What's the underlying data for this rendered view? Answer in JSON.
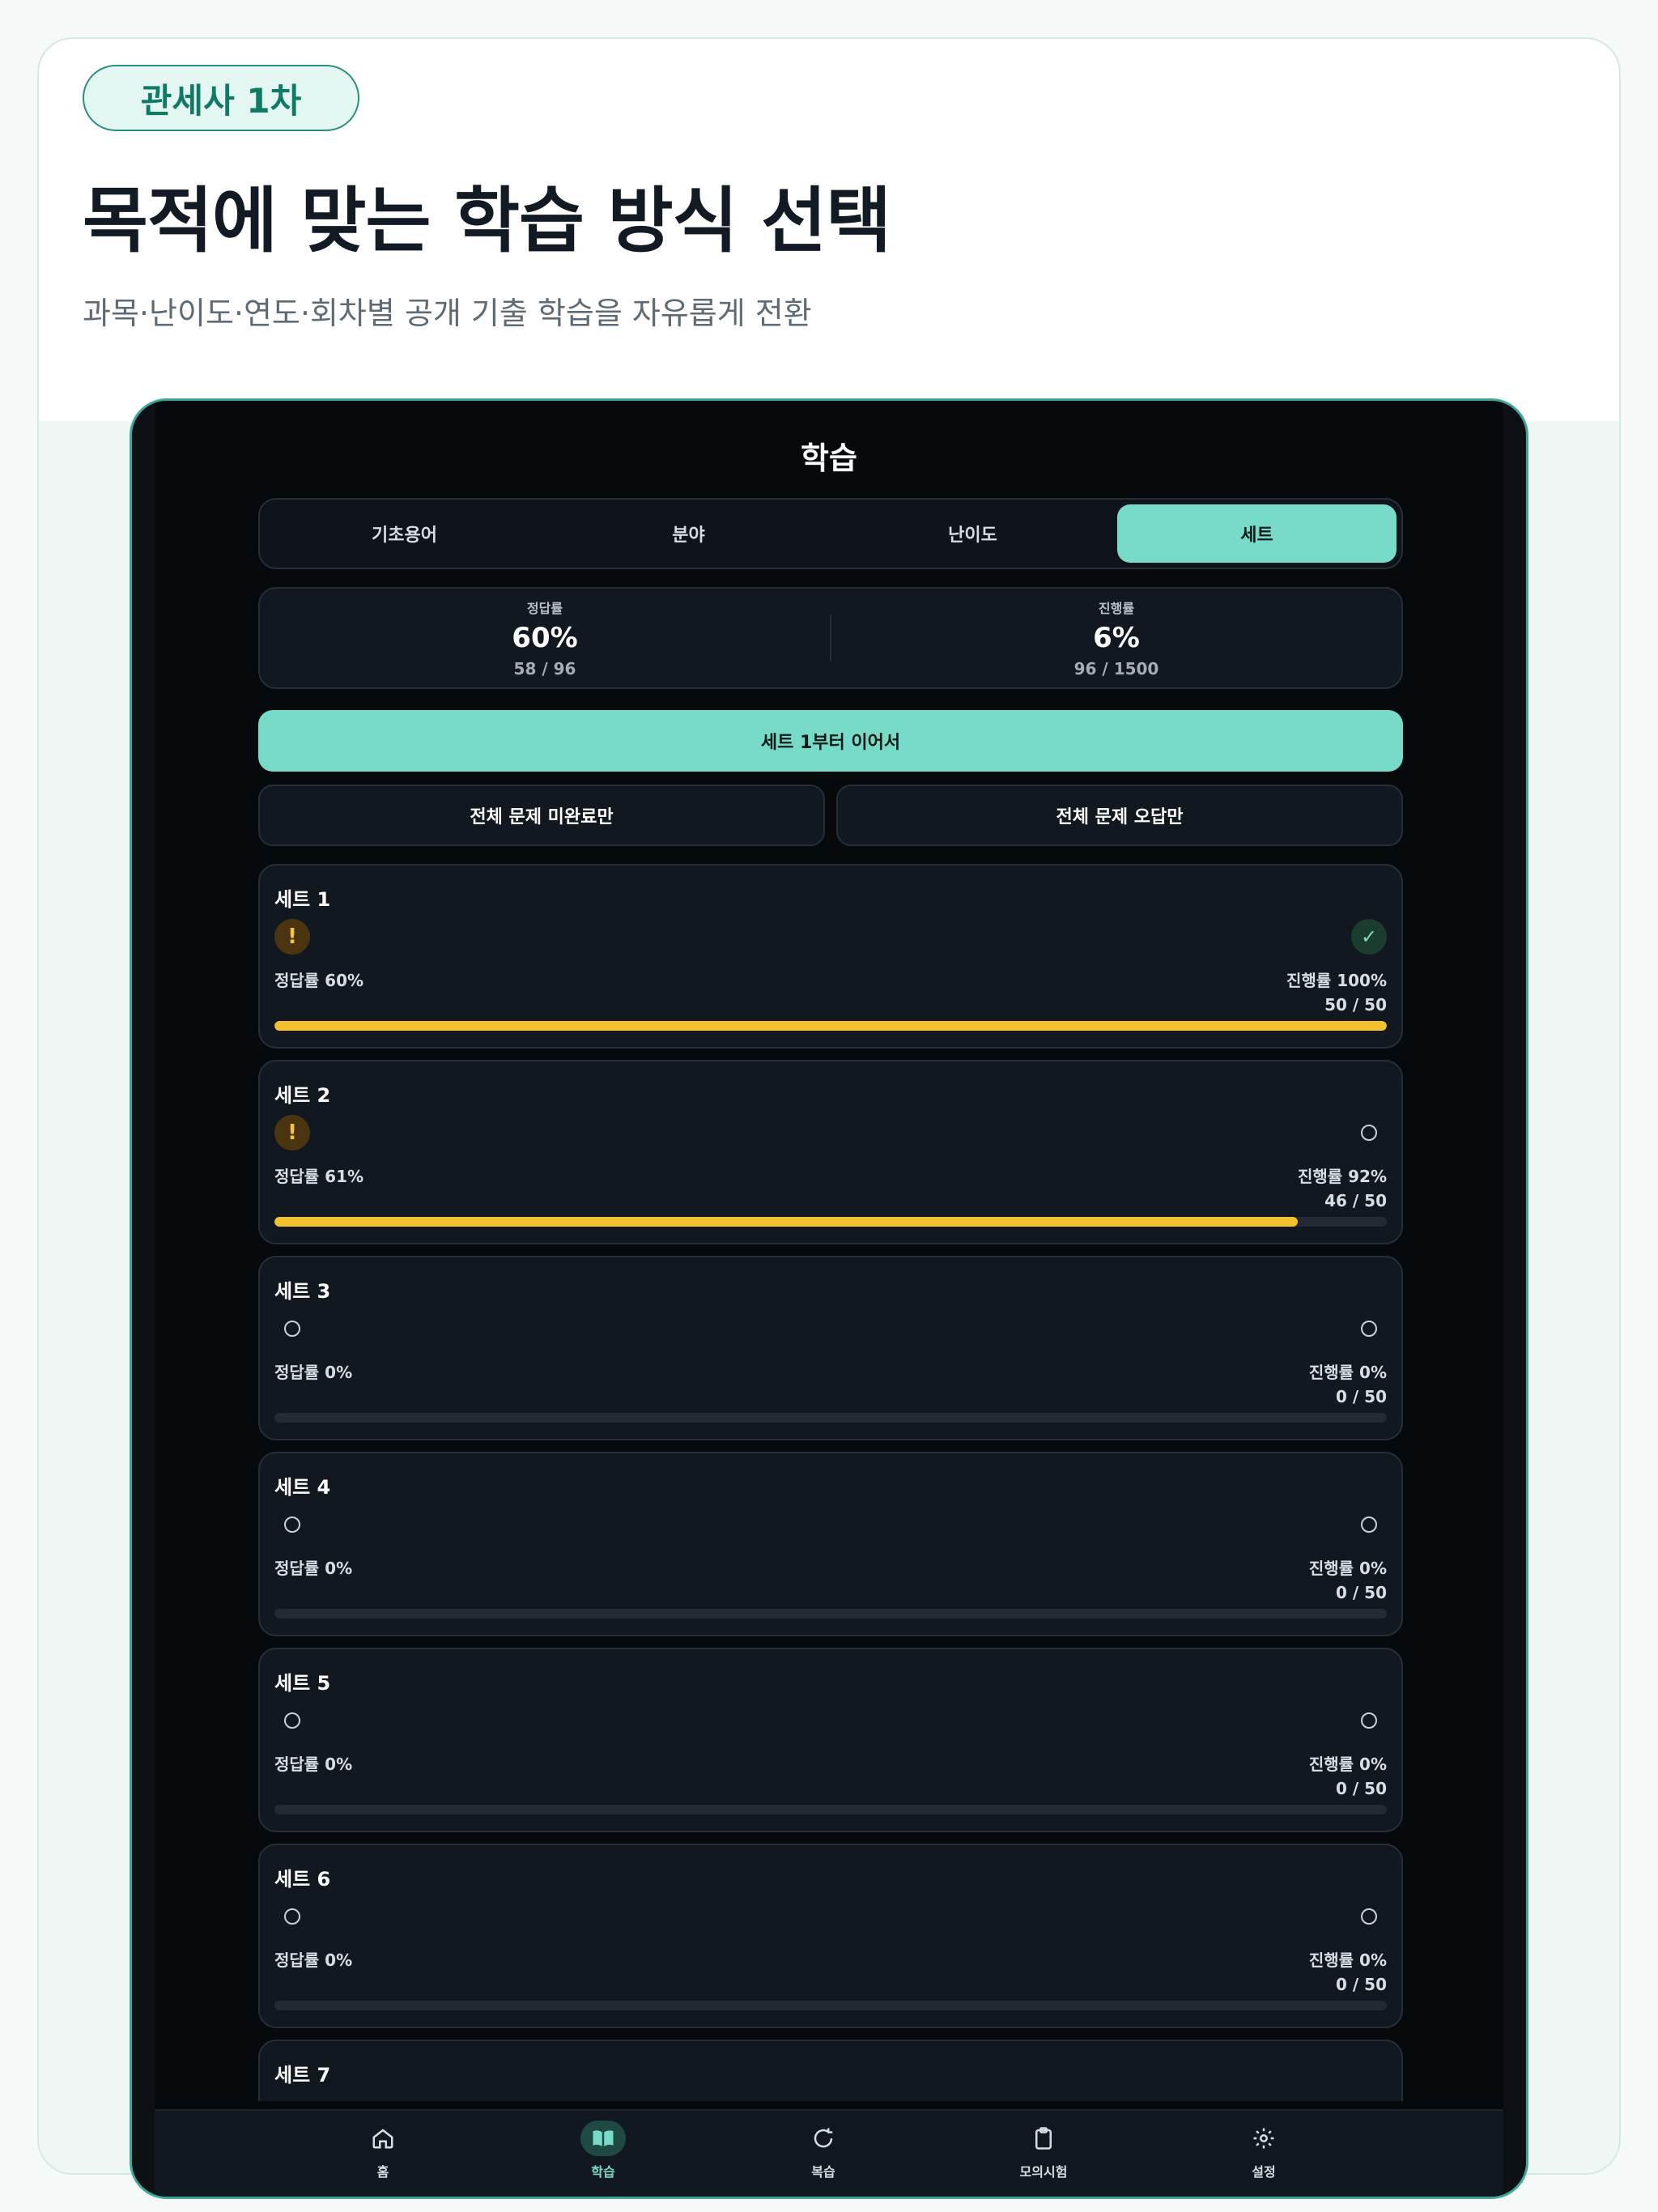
{
  "badge": "관세사 1차",
  "headline": "목적에 맞는 학습 방식 선택",
  "subline": "과목·난이도·연도·회차별 공개 기출 학습을 자유롭게 전환",
  "screen": {
    "title": "학습",
    "tabs": [
      {
        "label": "기초용어",
        "active": false
      },
      {
        "label": "분야",
        "active": false
      },
      {
        "label": "난이도",
        "active": false
      },
      {
        "label": "세트",
        "active": true
      }
    ],
    "stats": {
      "accuracy": {
        "label": "정답률",
        "value": "60%",
        "sub": "58 / 96"
      },
      "progress": {
        "label": "진행률",
        "value": "6%",
        "sub": "96 / 1500"
      }
    },
    "continue_label": "세트 1부터 이어서",
    "filter_incomplete": "전체 문제 미완료만",
    "filter_wrong": "전체 문제 오답만",
    "sets": [
      {
        "title": "세트 1",
        "accuracy": "정답률 60%",
        "progress": "진행률 100%",
        "count": "50 / 50",
        "fill": 1.0,
        "left_icon": "warning-icon",
        "right_icon": "check-icon"
      },
      {
        "title": "세트 2",
        "accuracy": "정답률 61%",
        "progress": "진행률 92%",
        "count": "46 / 50",
        "fill": 0.92,
        "left_icon": "warning-icon",
        "right_icon": "circle-icon"
      },
      {
        "title": "세트 3",
        "accuracy": "정답률 0%",
        "progress": "진행률 0%",
        "count": "0 / 50",
        "fill": 0,
        "left_icon": "circle-icon",
        "right_icon": "circle-icon"
      },
      {
        "title": "세트 4",
        "accuracy": "정답률 0%",
        "progress": "진행률 0%",
        "count": "0 / 50",
        "fill": 0,
        "left_icon": "circle-icon",
        "right_icon": "circle-icon"
      },
      {
        "title": "세트 5",
        "accuracy": "정답률 0%",
        "progress": "진행률 0%",
        "count": "0 / 50",
        "fill": 0,
        "left_icon": "circle-icon",
        "right_icon": "circle-icon"
      },
      {
        "title": "세트 6",
        "accuracy": "정답률 0%",
        "progress": "진행률 0%",
        "count": "0 / 50",
        "fill": 0,
        "left_icon": "circle-icon",
        "right_icon": "circle-icon"
      },
      {
        "title": "세트 7",
        "accuracy": "",
        "progress": "",
        "count": "",
        "fill": 0,
        "left_icon": "circle-icon",
        "right_icon": "circle-icon"
      }
    ],
    "nav": [
      {
        "label": "홈",
        "icon": "home-icon",
        "active": false
      },
      {
        "label": "학습",
        "icon": "book-icon",
        "active": true
      },
      {
        "label": "복습",
        "icon": "refresh-icon",
        "active": false
      },
      {
        "label": "모의시험",
        "icon": "clipboard-icon",
        "active": false
      },
      {
        "label": "설정",
        "icon": "gear-icon",
        "active": false
      }
    ]
  },
  "colors": {
    "accent": "#78dbc9",
    "progress_bar": "#f4c12e",
    "screen_bg": "#070a0d",
    "card_bg": "#121820"
  }
}
